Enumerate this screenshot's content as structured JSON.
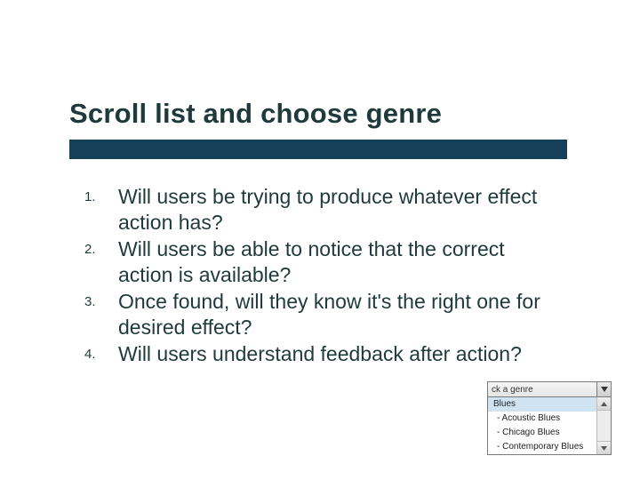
{
  "title": "Scroll list and choose genre",
  "items": [
    "Will users be trying to produce whatever effect action has?",
    "Will users be able to notice that the correct action is available?",
    "Once found, will they know it's the right one for desired effect?",
    "Will users understand feedback after action?"
  ],
  "dropdown": {
    "selected_fragment": "ck a genre",
    "options": [
      {
        "label": "Blues",
        "sub": false,
        "selected": true
      },
      {
        "label": "- Acoustic Blues",
        "sub": true,
        "selected": false
      },
      {
        "label": "- Chicago Blues",
        "sub": true,
        "selected": false
      },
      {
        "label": "- Contemporary Blues",
        "sub": true,
        "selected": false
      }
    ]
  }
}
